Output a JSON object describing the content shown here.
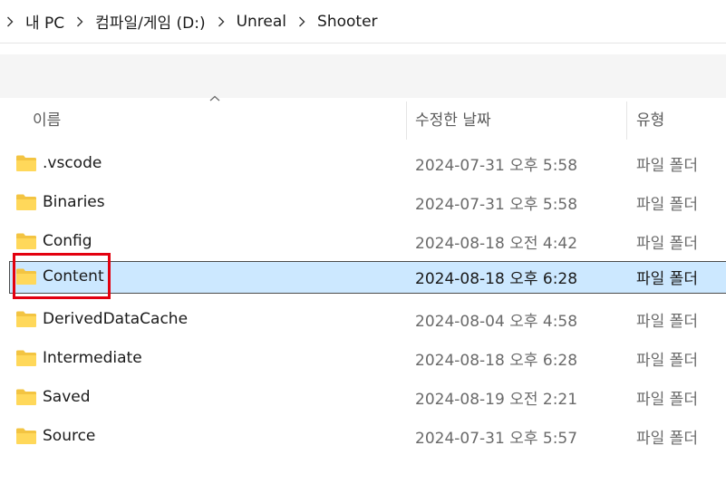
{
  "breadcrumb": {
    "segments": [
      "내 PC",
      "컴파일/게임 (D:)",
      "Unreal",
      "Shooter"
    ]
  },
  "columns": {
    "name": "이름",
    "date": "수정한 날짜",
    "type": "유형"
  },
  "rows": [
    {
      "name": ".vscode",
      "date": "2024-07-31 오후 5:58",
      "type": "파일 폴더",
      "selected": false
    },
    {
      "name": "Binaries",
      "date": "2024-07-31 오후 5:58",
      "type": "파일 폴더",
      "selected": false
    },
    {
      "name": "Config",
      "date": "2024-08-18 오전 4:42",
      "type": "파일 폴더",
      "selected": false
    },
    {
      "name": "Content",
      "date": "2024-08-18 오후 6:28",
      "type": "파일 폴더",
      "selected": true
    },
    {
      "name": "DerivedDataCache",
      "date": "2024-08-04 오후 4:58",
      "type": "파일 폴더",
      "selected": false
    },
    {
      "name": "Intermediate",
      "date": "2024-08-18 오후 6:28",
      "type": "파일 폴더",
      "selected": false
    },
    {
      "name": "Saved",
      "date": "2024-08-19 오전 2:21",
      "type": "파일 폴더",
      "selected": false
    },
    {
      "name": "Source",
      "date": "2024-07-31 오후 5:57",
      "type": "파일 폴더",
      "selected": false
    }
  ],
  "colors": {
    "selection": "#cce8ff",
    "highlight": "#e3000f",
    "folder": "#ffd85a"
  }
}
